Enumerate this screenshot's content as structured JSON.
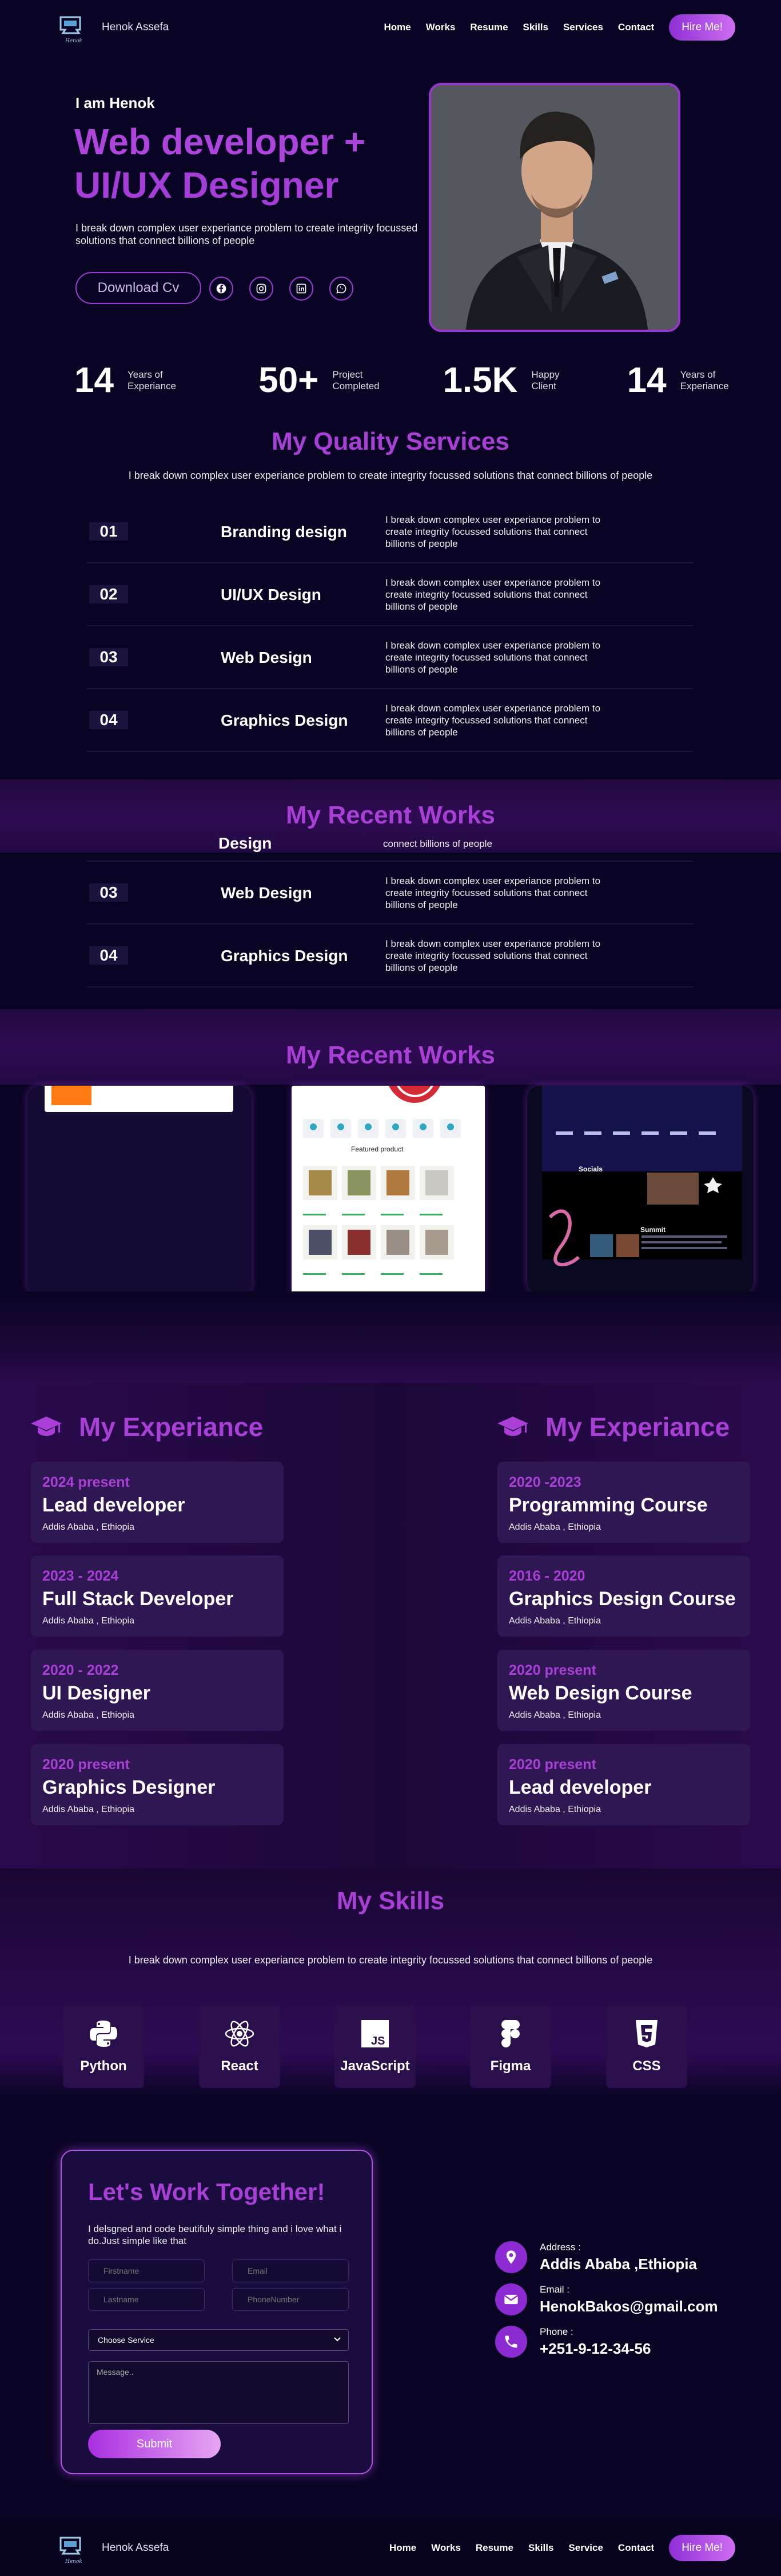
{
  "nav": {
    "brand": "Henok Assefa",
    "items": [
      "Home",
      "Works",
      "Resume",
      "Skills",
      "Services",
      "Contact"
    ],
    "hire": "Hire Me!"
  },
  "hero": {
    "intro": "I am Henok",
    "title_line1": "Web developer +",
    "title_line2": "UI/UX Designer",
    "desc": "I break down complex user experiance problem to create integrity focussed solutions that connect billions of people",
    "download": "Download Cv"
  },
  "stats": [
    {
      "num": "14",
      "l1": "Years of",
      "l2": "Experiance"
    },
    {
      "num": "50+",
      "l1": "Project",
      "l2": "Completed"
    },
    {
      "num": "1.5K",
      "l1": "Happy",
      "l2": "Client"
    },
    {
      "num": "14",
      "l1": "Years of",
      "l2": "Experiance"
    }
  ],
  "services": {
    "title": "My Quality Services",
    "subtitle": "I break down complex user experiance problem to create integrity focussed solutions that connect billions of people",
    "items": [
      {
        "num": "01",
        "name": "Branding design",
        "desc": "I break down complex user experiance problem to create integrity focussed solutions that connect billions of people"
      },
      {
        "num": "02",
        "name": "UI/UX Design",
        "desc": "I break down complex user experiance problem to create integrity focussed solutions that connect billions of people"
      },
      {
        "num": "03",
        "name": "Web Design",
        "desc": "I break down complex user experiance problem to create integrity focussed solutions that connect billions of people"
      },
      {
        "num": "04",
        "name": "Graphics Design",
        "desc": "I break down complex user experiance problem to create integrity focussed solutions that connect billions of people"
      }
    ]
  },
  "works": {
    "title": "My Recent Works",
    "partial_name": "Design",
    "partial_desc": "connect billions of people",
    "shop_heading": "Featured product",
    "dark_heading1": "Socials",
    "dark_heading2": "Summit"
  },
  "experience": {
    "title": "My Experiance",
    "left": [
      {
        "yr": "2024 present",
        "role": "Lead developer",
        "loc": "Addis Ababa , Ethiopia"
      },
      {
        "yr": "2023 - 2024",
        "role": "Full Stack Developer",
        "loc": "Addis Ababa , Ethiopia"
      },
      {
        "yr": "2020 - 2022",
        "role": "UI Designer",
        "loc": "Addis Ababa , Ethiopia"
      },
      {
        "yr": "2020 present",
        "role": "Graphics Designer",
        "loc": "Addis Ababa , Ethiopia"
      }
    ],
    "right": [
      {
        "yr": "2020 -2023",
        "role": "Programming Course",
        "loc": "Addis Ababa , Ethiopia"
      },
      {
        "yr": "2016 - 2020",
        "role": "Graphics Design Course",
        "loc": "Addis Ababa , Ethiopia"
      },
      {
        "yr": "2020 present",
        "role": "Web Design Course",
        "loc": "Addis Ababa , Ethiopia"
      },
      {
        "yr": "2020 present",
        "role": "Lead developer",
        "loc": "Addis Ababa , Ethiopia"
      }
    ]
  },
  "skills": {
    "title": "My Skills",
    "subtitle": "I break down complex user experiance problem to create integrity focussed solutions that connect billions of people",
    "items": [
      {
        "label": "Python",
        "icon": "python-icon"
      },
      {
        "label": "React",
        "icon": "react-icon"
      },
      {
        "label": "JavaScript",
        "icon": "javascript-icon"
      },
      {
        "label": "Figma",
        "icon": "figma-icon"
      },
      {
        "label": "CSS",
        "icon": "css-icon"
      }
    ]
  },
  "contact": {
    "title": "Let's Work Together!",
    "desc": "I delsgned and code beutifuly simple thing and i love what i do.Just simple like that",
    "firstname": "Firstname",
    "email": "Email",
    "lastname": "Lastname",
    "phone": "PhoneNumber",
    "service": "Choose Service",
    "message": "Message..",
    "submit": "Submit",
    "address_label": "Address :",
    "address_value": "Addis Ababa ,Ethiopia",
    "email_label": "Email :",
    "email_value": "HenokBakos@gmail.com",
    "phone_label": "Phone :",
    "phone_value": "+251-9-12-34-56"
  },
  "footer": {
    "brand": "Henok Assefa",
    "items": [
      "Home",
      "Works",
      "Resume",
      "Skills",
      "Service",
      "Contact"
    ],
    "hire": "Hire Me!"
  },
  "colors": {
    "accent": "#a93fd6",
    "bg": "#0a0424",
    "card": "#2e1752"
  }
}
